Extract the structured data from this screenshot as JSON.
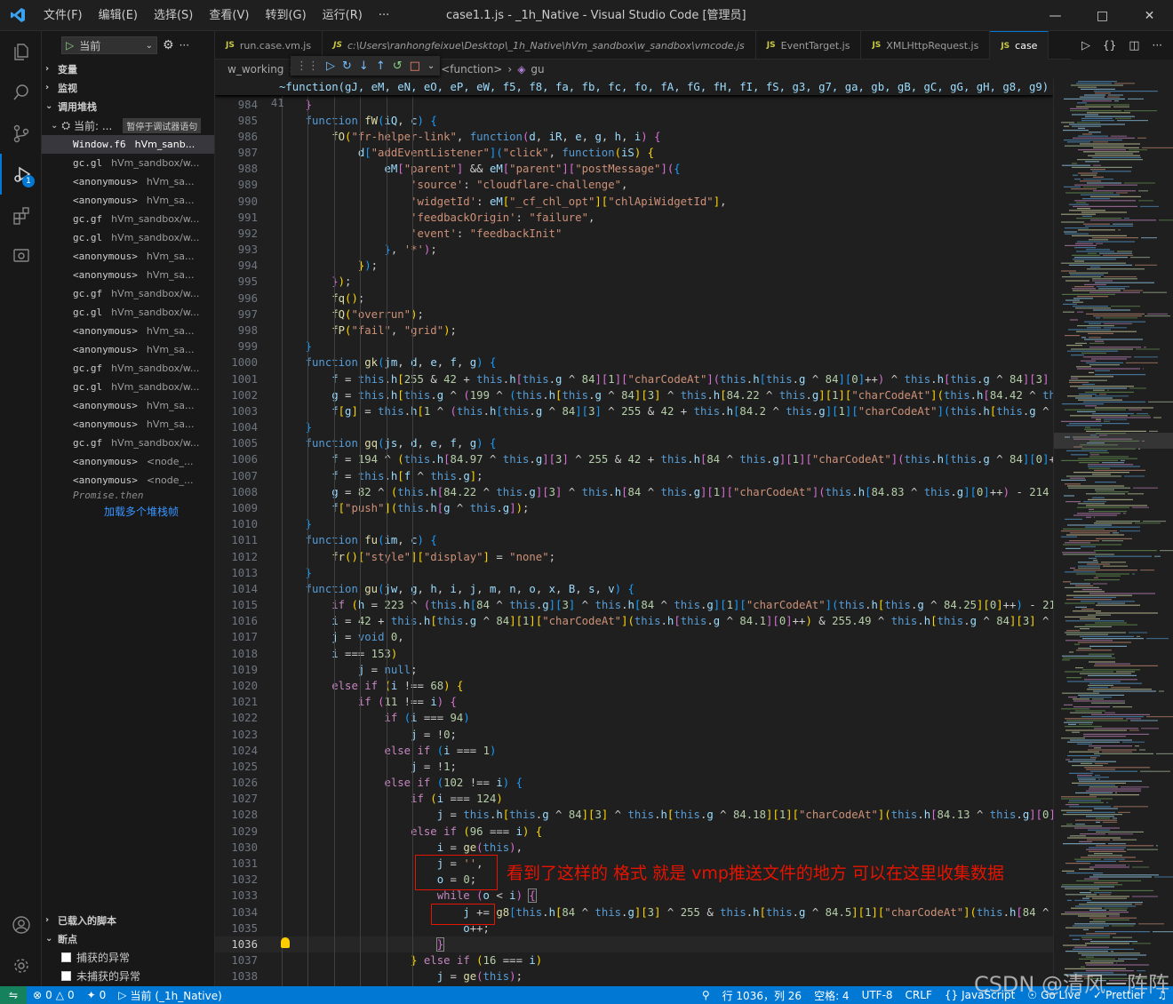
{
  "window": {
    "menu": [
      "文件(F)",
      "编辑(E)",
      "选择(S)",
      "查看(V)",
      "转到(G)",
      "运行(R)",
      "···"
    ],
    "title": "case1.1.js - _1h_Native - Visual Studio Code [管理员]"
  },
  "activity_bar": {
    "debug_badge": "1"
  },
  "sidebar": {
    "run_config": "当前",
    "sections": {
      "variables": "变量",
      "watch": "监视",
      "call_stack": "调用堆栈",
      "loaded_scripts": "已载入的脚本",
      "breakpoints": "断点"
    },
    "thread": {
      "label": "当前: ...",
      "status": "暂停于调试器语句"
    },
    "frames": [
      {
        "fn": "Window.f6",
        "src": "hVm_sanb..."
      },
      {
        "fn": "gc.gl",
        "src": "hVm_sandbox/w..."
      },
      {
        "fn": "<anonymous>",
        "src": "hVm_sa..."
      },
      {
        "fn": "<anonymous>",
        "src": "hVm_sa..."
      },
      {
        "fn": "gc.gf",
        "src": "hVm_sandbox/w..."
      },
      {
        "fn": "gc.gl",
        "src": "hVm_sandbox/w..."
      },
      {
        "fn": "<anonymous>",
        "src": "hVm_sa..."
      },
      {
        "fn": "<anonymous>",
        "src": "hVm_sa..."
      },
      {
        "fn": "gc.gf",
        "src": "hVm_sandbox/w..."
      },
      {
        "fn": "gc.gl",
        "src": "hVm_sandbox/w..."
      },
      {
        "fn": "<anonymous>",
        "src": "hVm_sa..."
      },
      {
        "fn": "<anonymous>",
        "src": "hVm_sa..."
      },
      {
        "fn": "gc.gf",
        "src": "hVm_sandbox/w..."
      },
      {
        "fn": "gc.gl",
        "src": "hVm_sandbox/w..."
      },
      {
        "fn": "<anonymous>",
        "src": "hVm_sa..."
      },
      {
        "fn": "<anonymous>",
        "src": "hVm_sa..."
      },
      {
        "fn": "gc.gf",
        "src": "hVm_sandbox/w..."
      },
      {
        "fn": "<anonymous>",
        "src": "<node_..."
      },
      {
        "fn": "<anonymous>",
        "src": "<node_..."
      }
    ],
    "promise_then": "Promise.then",
    "load_more": "加载多个堆栈帧",
    "bp_caught": "捕获的异常",
    "bp_uncaught": "未捕获的异常"
  },
  "tabs": [
    {
      "label": "run.case.vm.js",
      "active": false
    },
    {
      "label": "c:\\Users\\ranhongfeixue\\Desktop\\_1h_Native\\hVm_sandbox\\w_sandbox\\vmcode.js",
      "active": false
    },
    {
      "label": "EventTarget.js",
      "active": false
    },
    {
      "label": "XMLHttpRequest.js",
      "active": false
    },
    {
      "label": "case",
      "active": true
    }
  ],
  "tab_icon": "JS",
  "breadcrumb": {
    "folder": "w_working",
    "fn": "<function>",
    "symbol": "gu"
  },
  "editor": {
    "sticky_line_number": "41",
    "sticky_text": "~function(gJ, eM, eN, eO, eP, eW, f5, f8, fa, fb, fc, fo, fA, fG, fH, fI, fS, g3, g7, ga, gb, gB, gC, gG, gH, g8, g9)",
    "current_line": "1036",
    "annotation": "看到了这样的 格式 就是 vmp推送文件的地方 可以在这里收集数据"
  },
  "statusbar": {
    "errors": "0",
    "warnings": "0",
    "ports": "0",
    "debug_session": "当前 (_1h_Native)",
    "position": "行 1036，列 26",
    "spaces": "空格: 4",
    "encoding": "UTF-8",
    "eol": "CRLF",
    "language": "JavaScript",
    "golive": "Go Live",
    "prettier": "Prettier"
  },
  "watermark": "CSDN @清风一阵阵"
}
